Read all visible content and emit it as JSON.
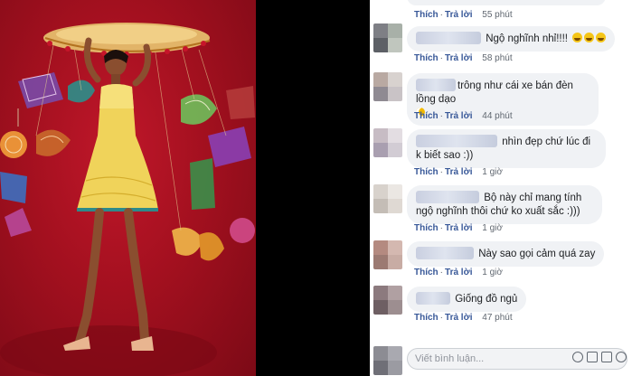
{
  "actions": {
    "like": "Thích",
    "reply": "Trả lời",
    "separator": "·"
  },
  "comments": [
    {
      "text": "",
      "time": "55 phút"
    },
    {
      "text": "Ngộ nghĩnh nhỉ!!!!",
      "time": "58 phút"
    },
    {
      "text": "trông như cái xe bán đèn lồng dạo",
      "time": "44 phút"
    },
    {
      "text": "nhìn đẹp chứ lúc đi k biết sao :))",
      "time": "1 giờ"
    },
    {
      "text": "Bộ này chỉ mang tính ngộ nghĩnh thôi chứ ko xuất sắc :)))",
      "time": "1 giờ"
    },
    {
      "text": "Này sao gọi cảm quá zay",
      "time": "1 giờ"
    },
    {
      "text": "Giống đồ ngủ",
      "time": "47 phút"
    }
  ],
  "composer": {
    "placeholder": "Viết bình luận..."
  },
  "icons": [
    "smiley-icon",
    "camera-icon",
    "gif-icon",
    "sticker-icon"
  ],
  "colors": {
    "link": "#385898",
    "bubble": "#f0f2f5",
    "photo_bg": "#a3101f"
  }
}
